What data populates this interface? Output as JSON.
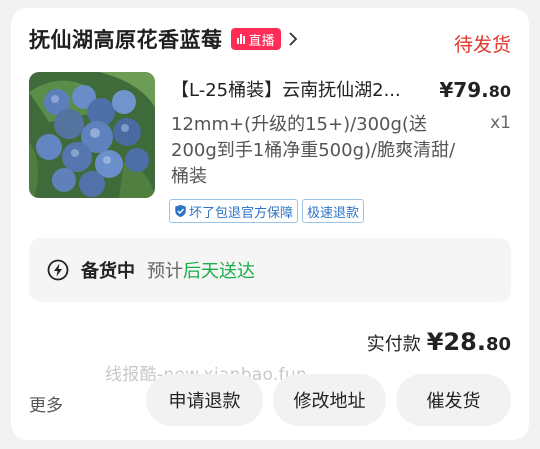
{
  "order": {
    "shop_name": "抚仙湖高原花香蓝莓",
    "live_badge": "直播",
    "status": "待发货",
    "product_title": "【L-25桶装】云南抚仙湖2...",
    "price_main": "¥79.",
    "price_decimal": "80",
    "spec": "12mm+(升级的15+)/300g(送200g到手1桶净重500g)/脆爽清甜/桶装",
    "quantity": "x1",
    "tags": [
      "坏了包退官方保障",
      "极速退款"
    ],
    "shipping": {
      "status": "备货中",
      "estimate_prefix": "预计",
      "estimate_time": "后天送达"
    },
    "paid_label": "实付款",
    "paid_main": "¥28.",
    "paid_decimal": "80",
    "watermark": "线报酷-new.xianbao.fun",
    "more_label": "更多",
    "buttons": {
      "refund": "申请退款",
      "change_address": "修改地址",
      "urge_shipping": "催发货"
    }
  },
  "colors": {
    "status_red": "#e0362a",
    "live_badge": "#ff2d55",
    "eta_green": "#1aad4a",
    "tag_blue": "#2e74c6"
  },
  "icons": {
    "live": "live-bars-icon",
    "chevron": "chevron-right-icon",
    "shield": "shield-check-icon",
    "shipping": "lightning-circle-icon"
  }
}
